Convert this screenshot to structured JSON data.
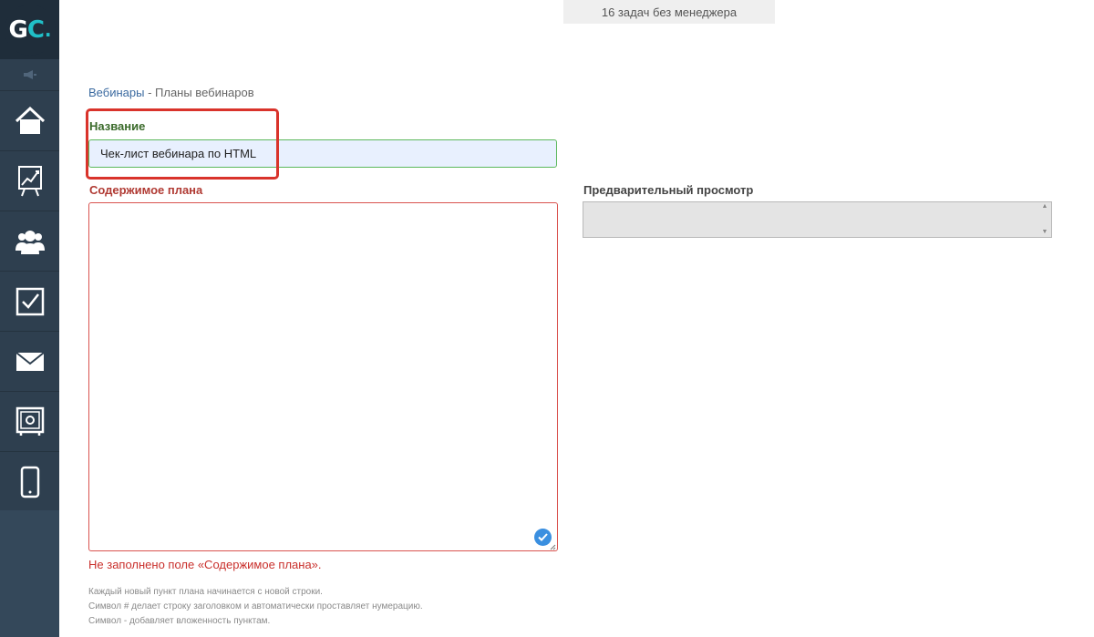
{
  "logo": {
    "g": "G",
    "c": "C",
    "dot": "."
  },
  "sidebar": {
    "items": [
      {
        "icon": "home-icon"
      },
      {
        "icon": "chart-board-icon"
      },
      {
        "icon": "users-icon"
      },
      {
        "icon": "tasks-checkbox-icon"
      },
      {
        "icon": "mail-icon"
      },
      {
        "icon": "safe-icon"
      },
      {
        "icon": "mobile-icon"
      }
    ]
  },
  "top_notice": "16 задач без менеджера",
  "breadcrumb": {
    "link": "Вебинары",
    "separator": " - ",
    "current": "Планы вебинаров"
  },
  "form": {
    "name_label": "Название",
    "name_value": "Чек-лист вебинара по HTML",
    "content_label": "Содержимое плана",
    "content_value": "",
    "error": "Не заполнено поле «Содержимое плана».",
    "help": [
      "Каждый новый пункт плана начинается с новой строки.",
      "Символ # делает строку заголовком и автоматически проставляет нумерацию.",
      "Символ - добавляет вложенность пунктам."
    ]
  },
  "preview": {
    "label": "Предварительный просмотр"
  },
  "colors": {
    "sidebar": "#2e3f4f",
    "accent": "#20c0c8",
    "error": "#d9332b",
    "success": "#5cb85c"
  }
}
